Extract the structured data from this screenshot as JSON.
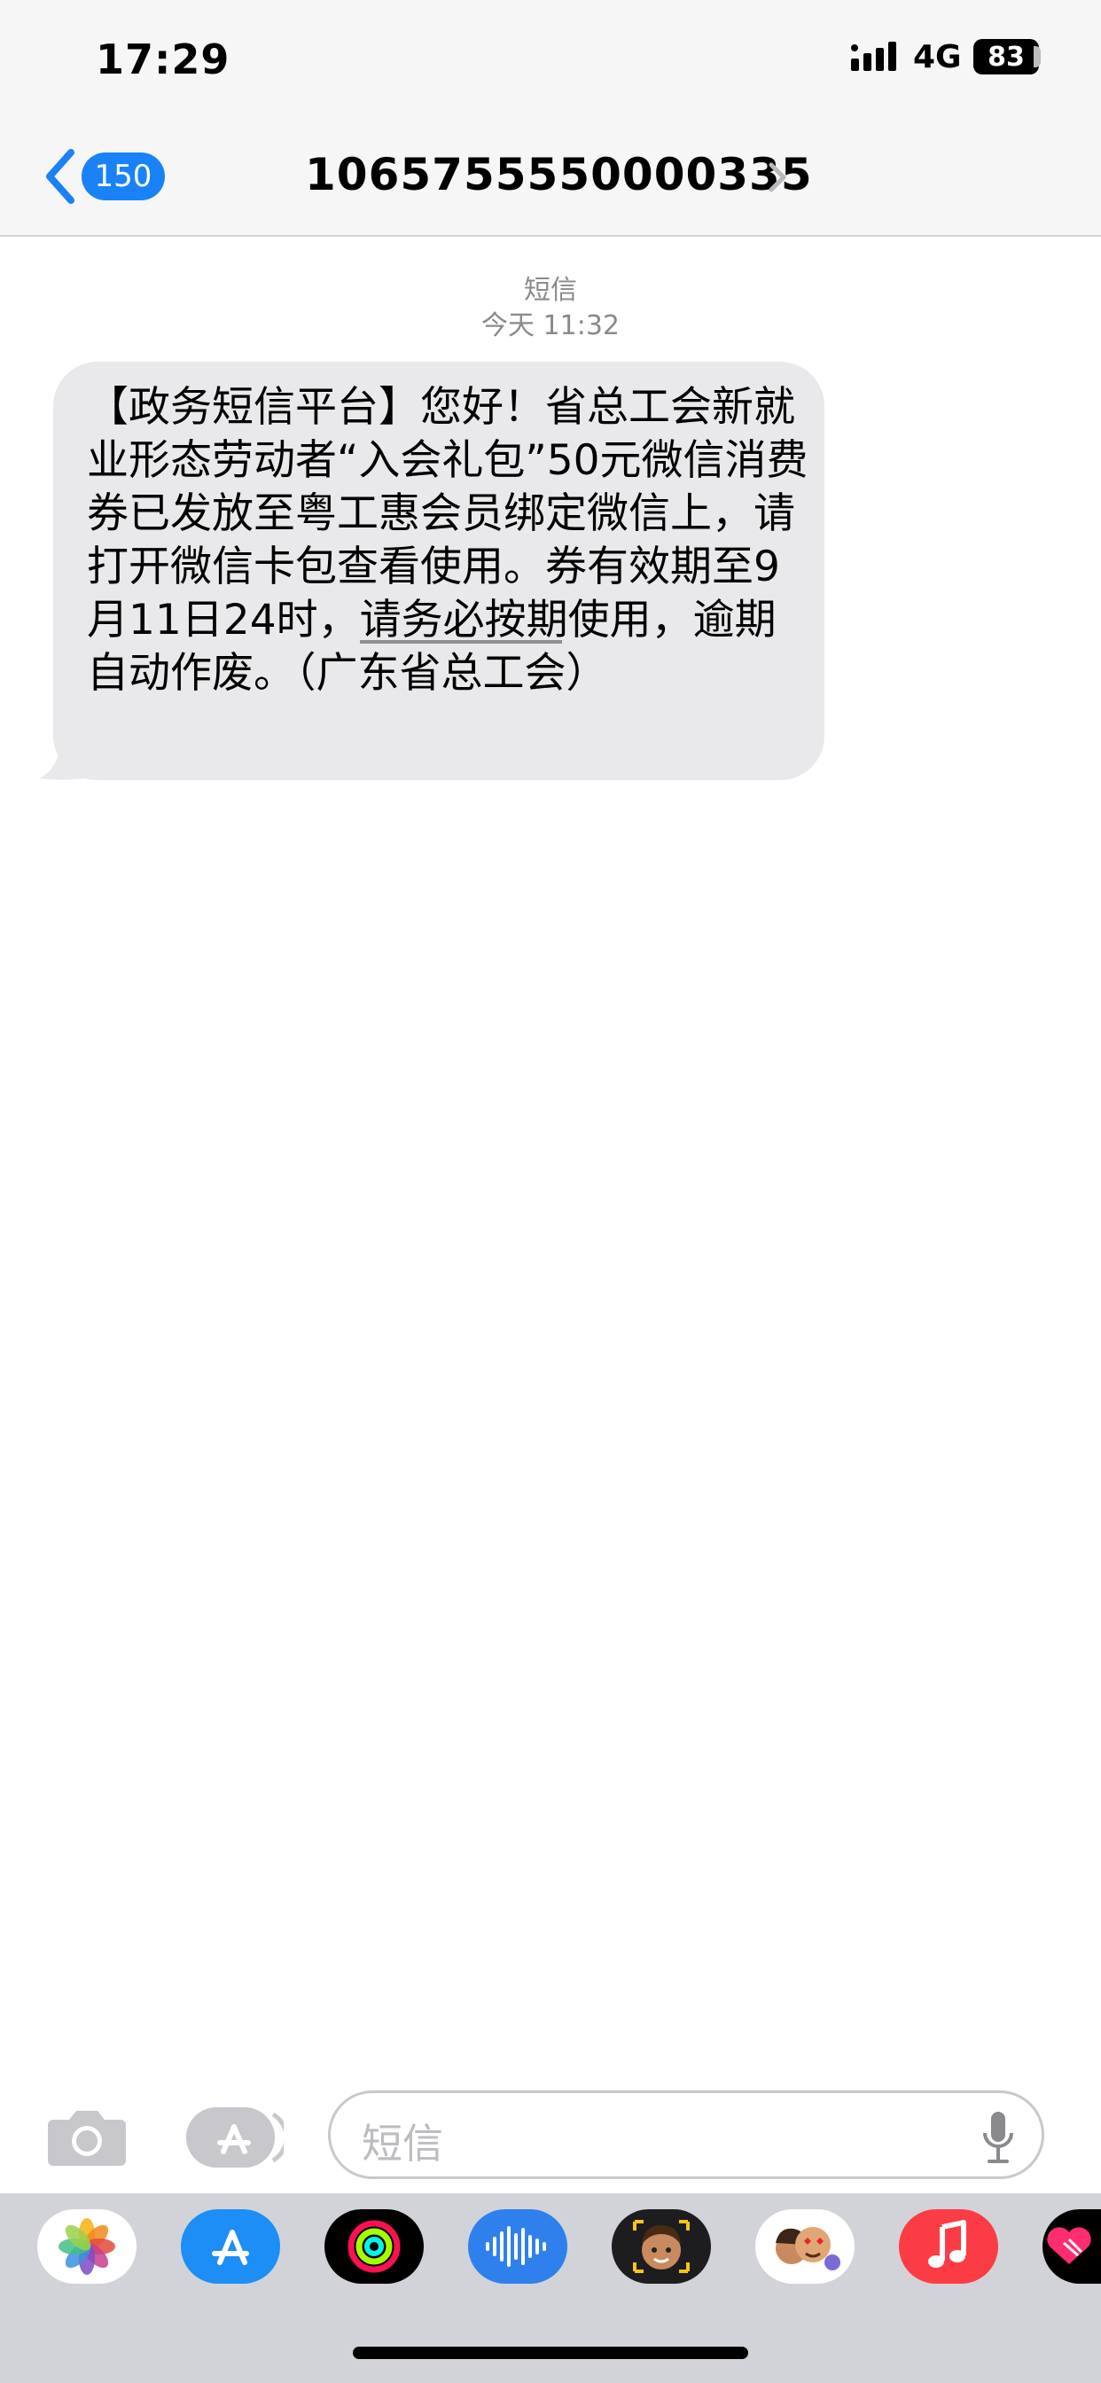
{
  "status_bar": {
    "time": "17:29",
    "network": "4G",
    "battery": "83"
  },
  "nav": {
    "back_count": "150",
    "contact": "1065755550000335"
  },
  "thread": {
    "service": "短信",
    "date": "今天 11:32"
  },
  "message": {
    "text": "【政务短信平台】您好！省总工会新就业形态劳动者“入会礼包”50元微信消费券已发放至粤工惠会员绑定微信上，请打开微信卡包查看使用。券有效期至9月11日24时，请务必按期使用，逾期自动作废。（广东省总工会）"
  },
  "input": {
    "placeholder": "短信"
  },
  "app_drawer": {
    "apps": [
      "photos-icon",
      "app-store-icon",
      "fitness-icon",
      "audio-message-icon",
      "memoji-icon",
      "memoji-stickers-icon",
      "music-icon",
      "digital-touch-icon"
    ],
    "colors": {
      "accent": "#1a82f7",
      "bubble": "#e9e9eb",
      "drawer": "#d1d3d9"
    }
  }
}
